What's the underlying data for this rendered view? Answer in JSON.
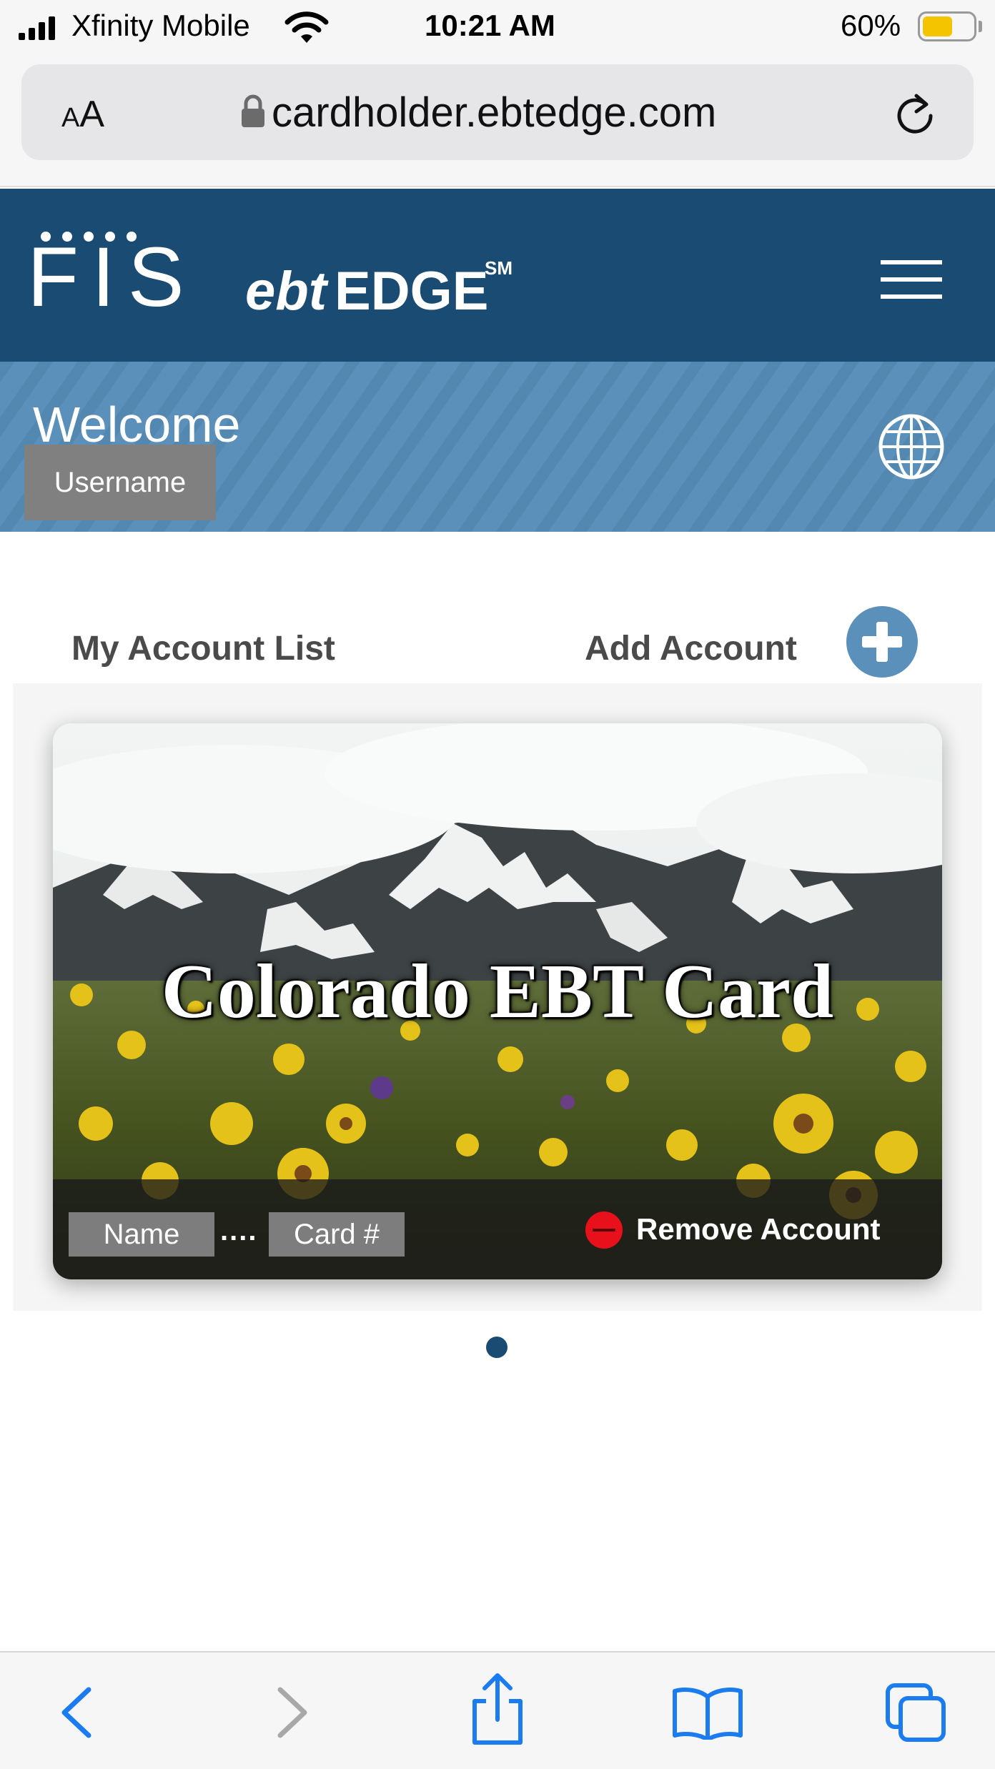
{
  "status_bar": {
    "carrier": "Xfinity Mobile",
    "time": "10:21 AM",
    "battery": "60%",
    "battery_level": 0.6
  },
  "browser": {
    "text_size_label": "AA",
    "url": "cardholder.ebtedge.com"
  },
  "header": {
    "logo_fis": "FIS",
    "logo_ebt": "ebt",
    "logo_edge": "EDGE",
    "logo_sm": "SM"
  },
  "welcome": {
    "title": "Welcome",
    "username_placeholder": "Username"
  },
  "accounts": {
    "list_title": "My Account List",
    "add_label": "Add Account",
    "card": {
      "title": "Colorado EBT Card",
      "name_placeholder": "Name",
      "mask": "....",
      "card_number_placeholder": "Card #",
      "remove_label": "Remove Account"
    }
  },
  "colors": {
    "header_bg": "#1a4b73",
    "welcome_bg": "#5a90ba",
    "add_button": "#5a90ba",
    "remove_icon": "#e8101a",
    "safari_blue": "#1a7cf0"
  },
  "toolbar": {
    "icons": [
      "back-icon",
      "forward-icon",
      "share-icon",
      "bookmarks-icon",
      "tabs-icon"
    ]
  }
}
